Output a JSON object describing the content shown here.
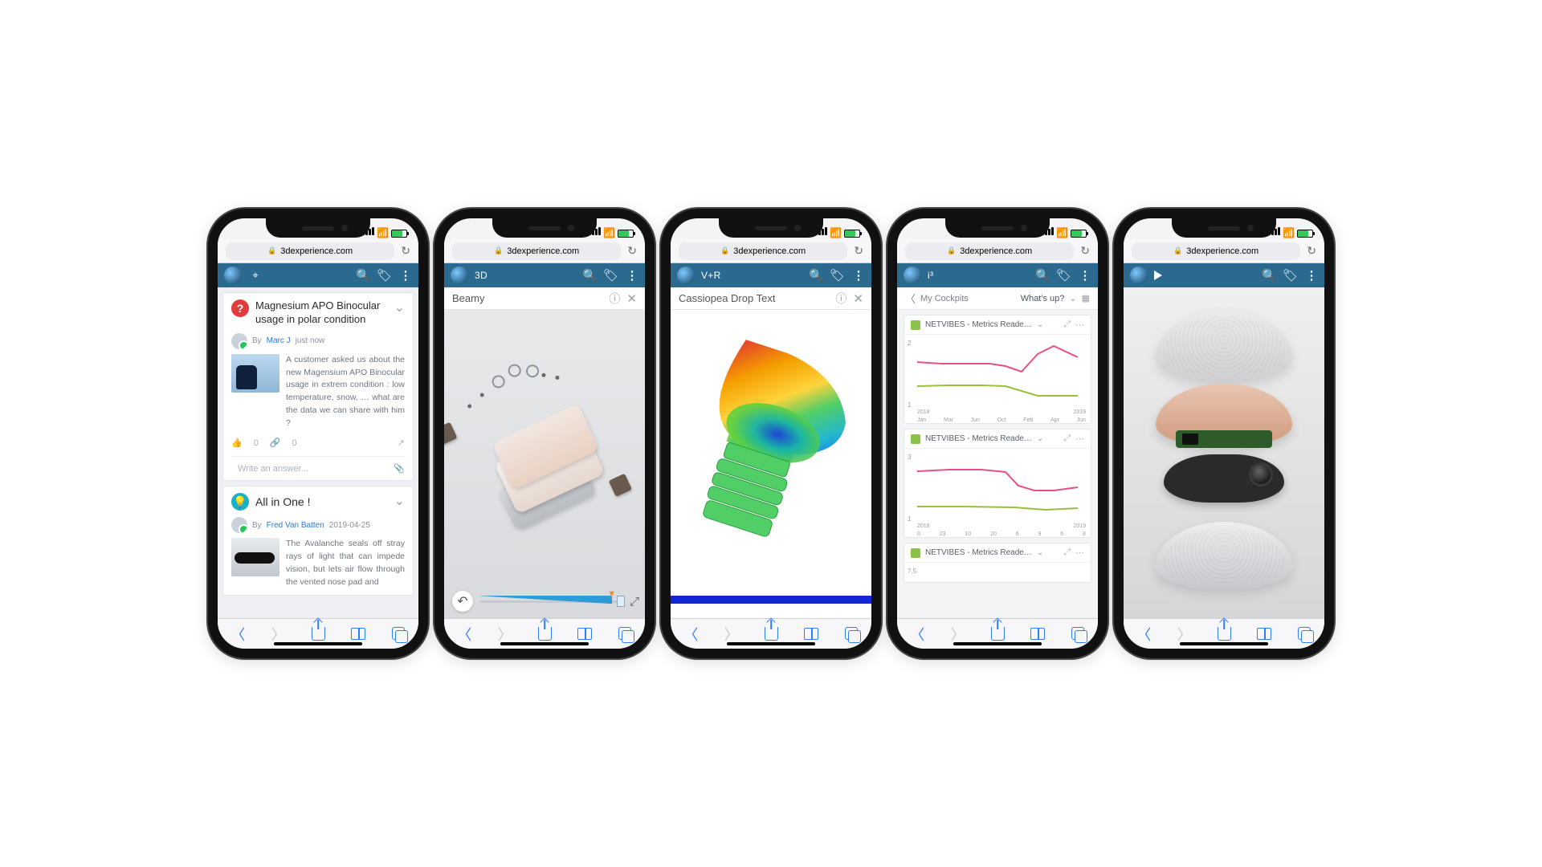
{
  "url": "3dexperience.com",
  "apps": {
    "feed": {
      "label": ""
    },
    "three": {
      "label": "3D"
    },
    "sim": {
      "label": "V+R"
    },
    "dash": {
      "label": "i³"
    },
    "play": {
      "label": ""
    }
  },
  "phone1": {
    "post1": {
      "title": "Magnesium APO Binocular usage in polar condition",
      "by_prefix": "By",
      "author": "Marc J",
      "time": "just now",
      "body": "A customer asked us about the new Magensium APO Binocular usage in extrem condition : low temperature, snow, … what are the data we can share with him ?",
      "like_count": "0",
      "link_count": "0",
      "answer_placeholder": "Write an answer..."
    },
    "post2": {
      "title": "All in One !",
      "by_prefix": "By",
      "author": "Fred Van Batten",
      "time": "2019-04-25",
      "body": "The Avalanche seals off stray rays of light that can impede vision, but lets air flow through the vented nose pad and"
    }
  },
  "phone2": {
    "model_name": "Beamy"
  },
  "phone3": {
    "model_name": "Cassiopea Drop Text"
  },
  "phone4": {
    "back_label": "My Cockpits",
    "picker_label": "What's up?",
    "widget_title": "NETVIBES - Metrics Reade…",
    "chart_y": [
      "2",
      "1"
    ],
    "chart_y2": [
      "3",
      "1"
    ],
    "chart_y3_top": "7.5",
    "chart_x_months": [
      "Jan",
      "Mar",
      "Jun",
      "Oct",
      "Feb",
      "Apr",
      "Jun"
    ],
    "chart_x_months2": [
      "0",
      "23",
      "10",
      "20",
      "6",
      "9",
      "6",
      "8"
    ],
    "year_left": "2018",
    "year_right": "2019"
  }
}
